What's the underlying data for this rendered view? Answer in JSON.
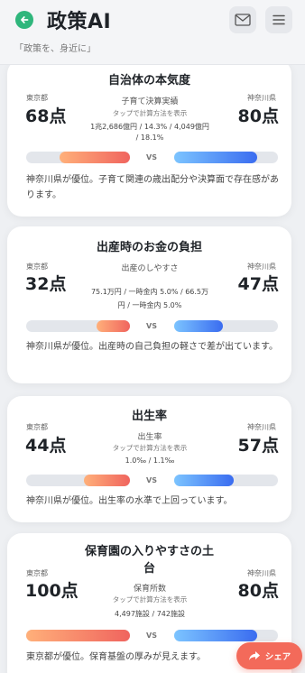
{
  "header": {
    "title": "政策AI",
    "tagline": "「政策を、身近に」"
  },
  "cards": [
    {
      "title": "自治体の本気度",
      "left_label": "東京都",
      "right_label": "神奈川県",
      "left_score": "68点",
      "right_score": "80点",
      "metric": "子育て決算実績",
      "hint": "タップで計算方法を表示",
      "values_line1": "1兆2,686億円 / 14.3% / 4,049億円",
      "values_line2": "/ 18.1%",
      "vs": "VS",
      "left_fill": 0.68,
      "right_fill": 0.8,
      "comment": "神奈川県が優位。子育て関連の歳出配分や決算面で存在感があります。"
    },
    {
      "title": "出産時のお金の負担",
      "left_label": "東京都",
      "right_label": "神奈川県",
      "left_score": "32点",
      "right_score": "47点",
      "metric": "出産のしやすさ",
      "values_line1": "75.1万円 / 一時金内 5.0% / 66.5万",
      "values_line2": "円 / 一時金内 5.0%",
      "vs": "VS",
      "left_fill": 0.32,
      "right_fill": 0.47,
      "comment": "神奈川県が優位。出産時の自己負担の軽さで差が出ています。"
    },
    {
      "title": "出生率",
      "left_label": "東京都",
      "right_label": "神奈川県",
      "left_score": "44点",
      "right_score": "57点",
      "metric": "出生率",
      "hint": "タップで計算方法を表示",
      "values_line1": "1.0‰ / 1.1‰",
      "vs": "VS",
      "left_fill": 0.44,
      "right_fill": 0.57,
      "comment": "神奈川県が優位。出生率の水準で上回っています。"
    },
    {
      "title_line1": "保育園の入りやすさの土",
      "title_line2": "台",
      "left_label": "東京都",
      "right_label": "神奈川県",
      "left_score": "100点",
      "right_score": "80点",
      "metric": "保育所数",
      "hint": "タップで計算方法を表示",
      "values_line1": "4,497施設 / 742施設",
      "vs": "VS",
      "left_fill": 1.0,
      "right_fill": 0.8,
      "comment": "東京都が優位。保育基盤の厚みが見えます。"
    }
  ],
  "share": {
    "label": "シェア"
  },
  "colors": {
    "accent": "#2fb67c",
    "tokyo": "#f0645e",
    "kanagawa": "#3a6cf0",
    "share": "#f36a5a"
  }
}
